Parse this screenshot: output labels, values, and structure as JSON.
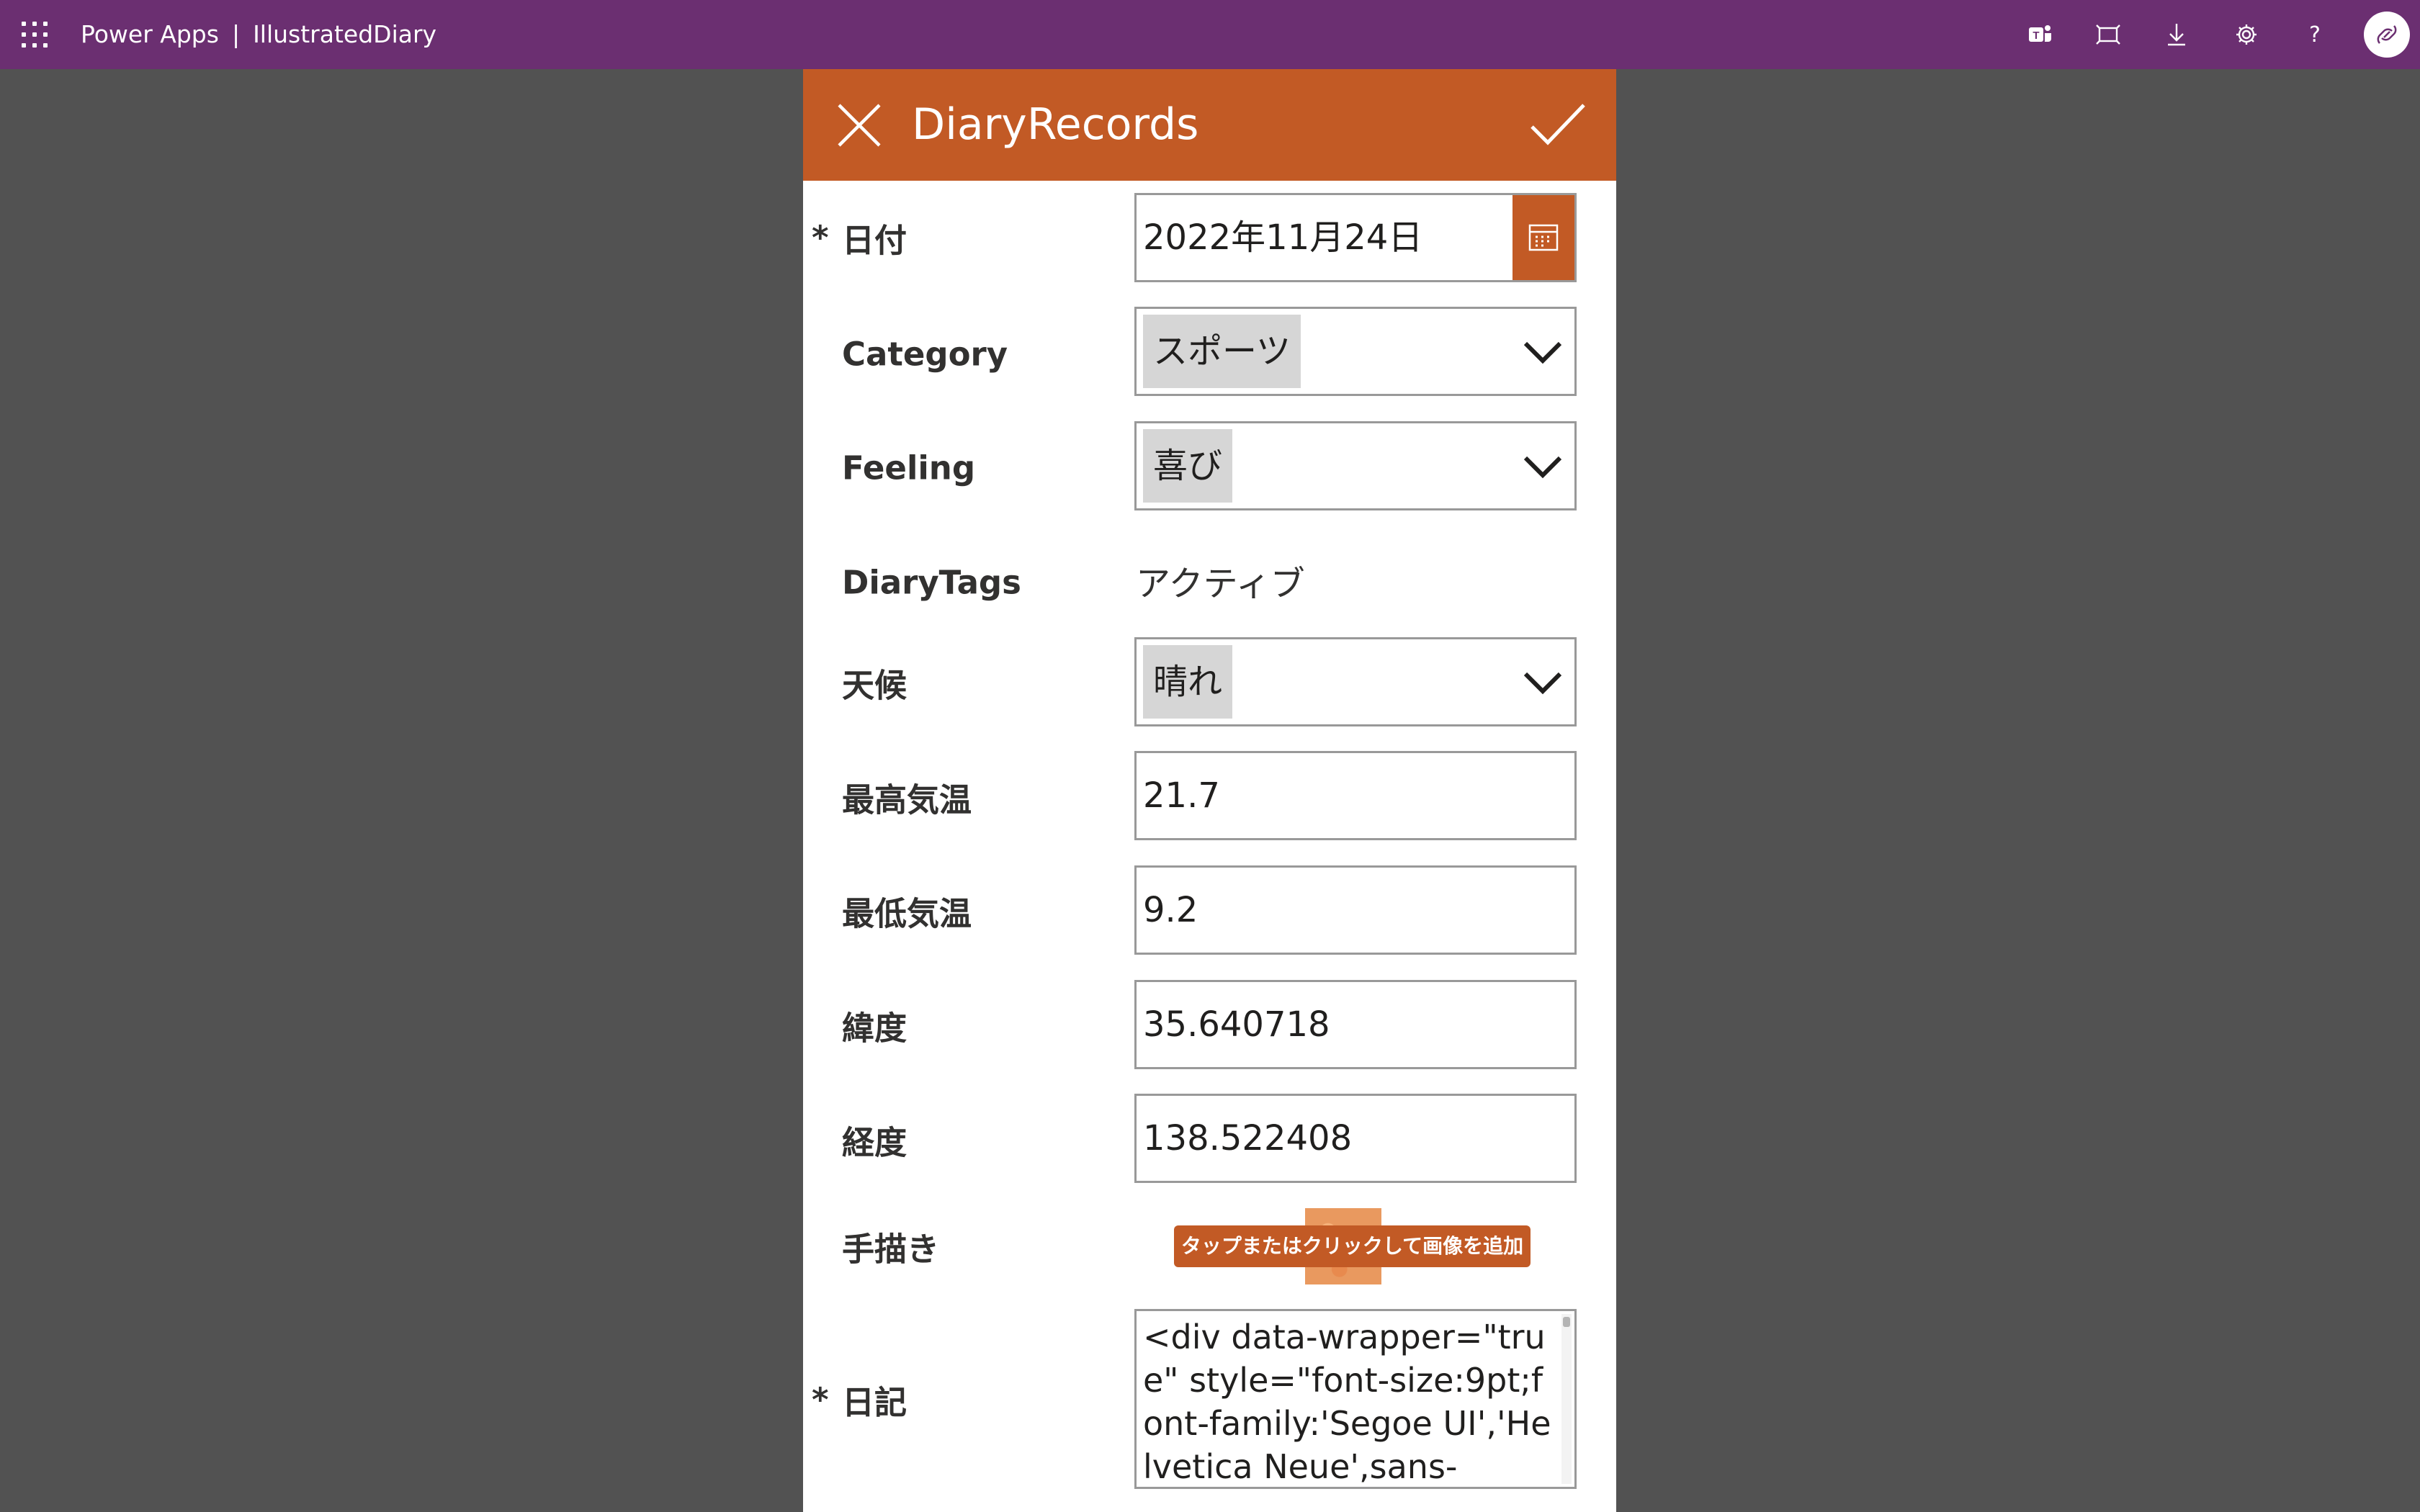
{
  "topbar": {
    "brand": "Power Apps",
    "separator": "|",
    "app_name": "IllustratedDiary",
    "background": "#6b2f71",
    "icons": [
      "teams-icon",
      "fit-to-window-icon",
      "download-icon",
      "settings-icon",
      "help-icon",
      "avatar"
    ]
  },
  "form": {
    "title": "DiaryRecords",
    "accent": "#c25a25",
    "required_marker": "*",
    "fields": {
      "date": {
        "label": "日付",
        "value": "2022年11月24日"
      },
      "category": {
        "label": "Category",
        "value": "スポーツ"
      },
      "feeling": {
        "label": "Feeling",
        "value": "喜び"
      },
      "diary_tags": {
        "label": "DiaryTags",
        "value": "アクティブ"
      },
      "weather": {
        "label": "天候",
        "value": "晴れ"
      },
      "max_temp": {
        "label": "最高気温",
        "value": "21.7"
      },
      "min_temp": {
        "label": "最低気温",
        "value": "9.2"
      },
      "latitude": {
        "label": "緯度",
        "value": "35.640718"
      },
      "longitude": {
        "label": "経度",
        "value": "138.522408"
      },
      "drawing": {
        "label": "手描き",
        "add_image_label": "タップまたはクリックして画像を追加"
      },
      "diary": {
        "label": "日記",
        "value": "<div data-wrapper=\"true\" style=\"font-size:9pt;font-family:'Segoe UI','Helvetica Neue',sans-"
      }
    }
  }
}
